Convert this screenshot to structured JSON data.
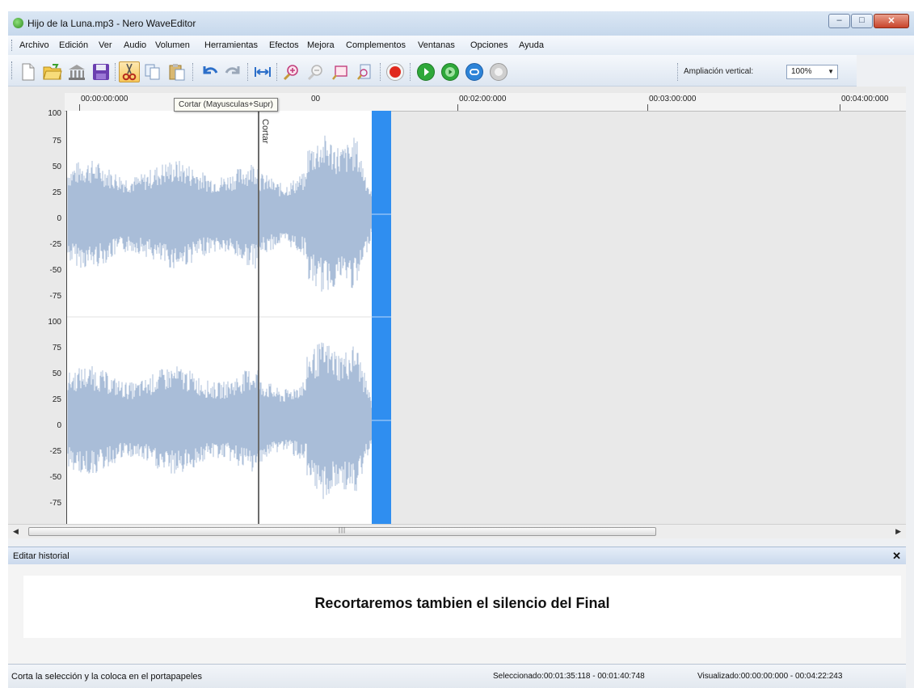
{
  "window": {
    "title": "Hijo de la Luna.mp3 - Nero WaveEditor"
  },
  "menu": {
    "items": [
      "Archivo",
      "Edición",
      "Ver",
      "Audio",
      "Volumen",
      "Herramientas",
      "Efectos",
      "Mejora",
      "Complementos",
      "Ventanas",
      "Opciones",
      "Ayuda"
    ]
  },
  "toolbar": {
    "zoom_label": "Ampliación vertical:",
    "zoom_value": "100%",
    "active_tool": "cut-icon",
    "icons": [
      "new-file-icon",
      "open-folder-icon",
      "library-icon",
      "save-icon",
      "cut-icon",
      "copy-icon",
      "paste-icon",
      "undo-icon",
      "redo-icon",
      "fit-width-icon",
      "zoom-in-icon",
      "zoom-out-icon",
      "zoom-selection-icon",
      "zoom-full-icon",
      "record-icon",
      "play-icon",
      "play-selection-icon",
      "loop-icon",
      "stop-icon"
    ]
  },
  "tooltip": {
    "text": "Cortar (Mayusculas+Supr)"
  },
  "ruler": {
    "labels": [
      "00:00:00:000",
      "00",
      "00:02:00:000",
      "00:03:00:000",
      "00:04:00:000"
    ]
  },
  "channels": {
    "y_labels": [
      "100",
      "75",
      "50",
      "25",
      "0",
      "-25",
      "-50",
      "-75"
    ]
  },
  "markers": {
    "cut_label": "Cortar"
  },
  "history": {
    "title": "Editar historial",
    "message": "Recortaremos tambien el silencio del Final"
  },
  "status": {
    "hint": "Corta la selección y la coloca en el portapapeles",
    "selected": "Seleccionado:00:01:35:118 - 00:01:40:748",
    "visualized": "Visualizado:00:00:00:000 - 00:04:22:243"
  },
  "colors": {
    "waveform": "#a9bdd8",
    "selection": "#2f8ef0",
    "marker": "#6b6b6b"
  }
}
